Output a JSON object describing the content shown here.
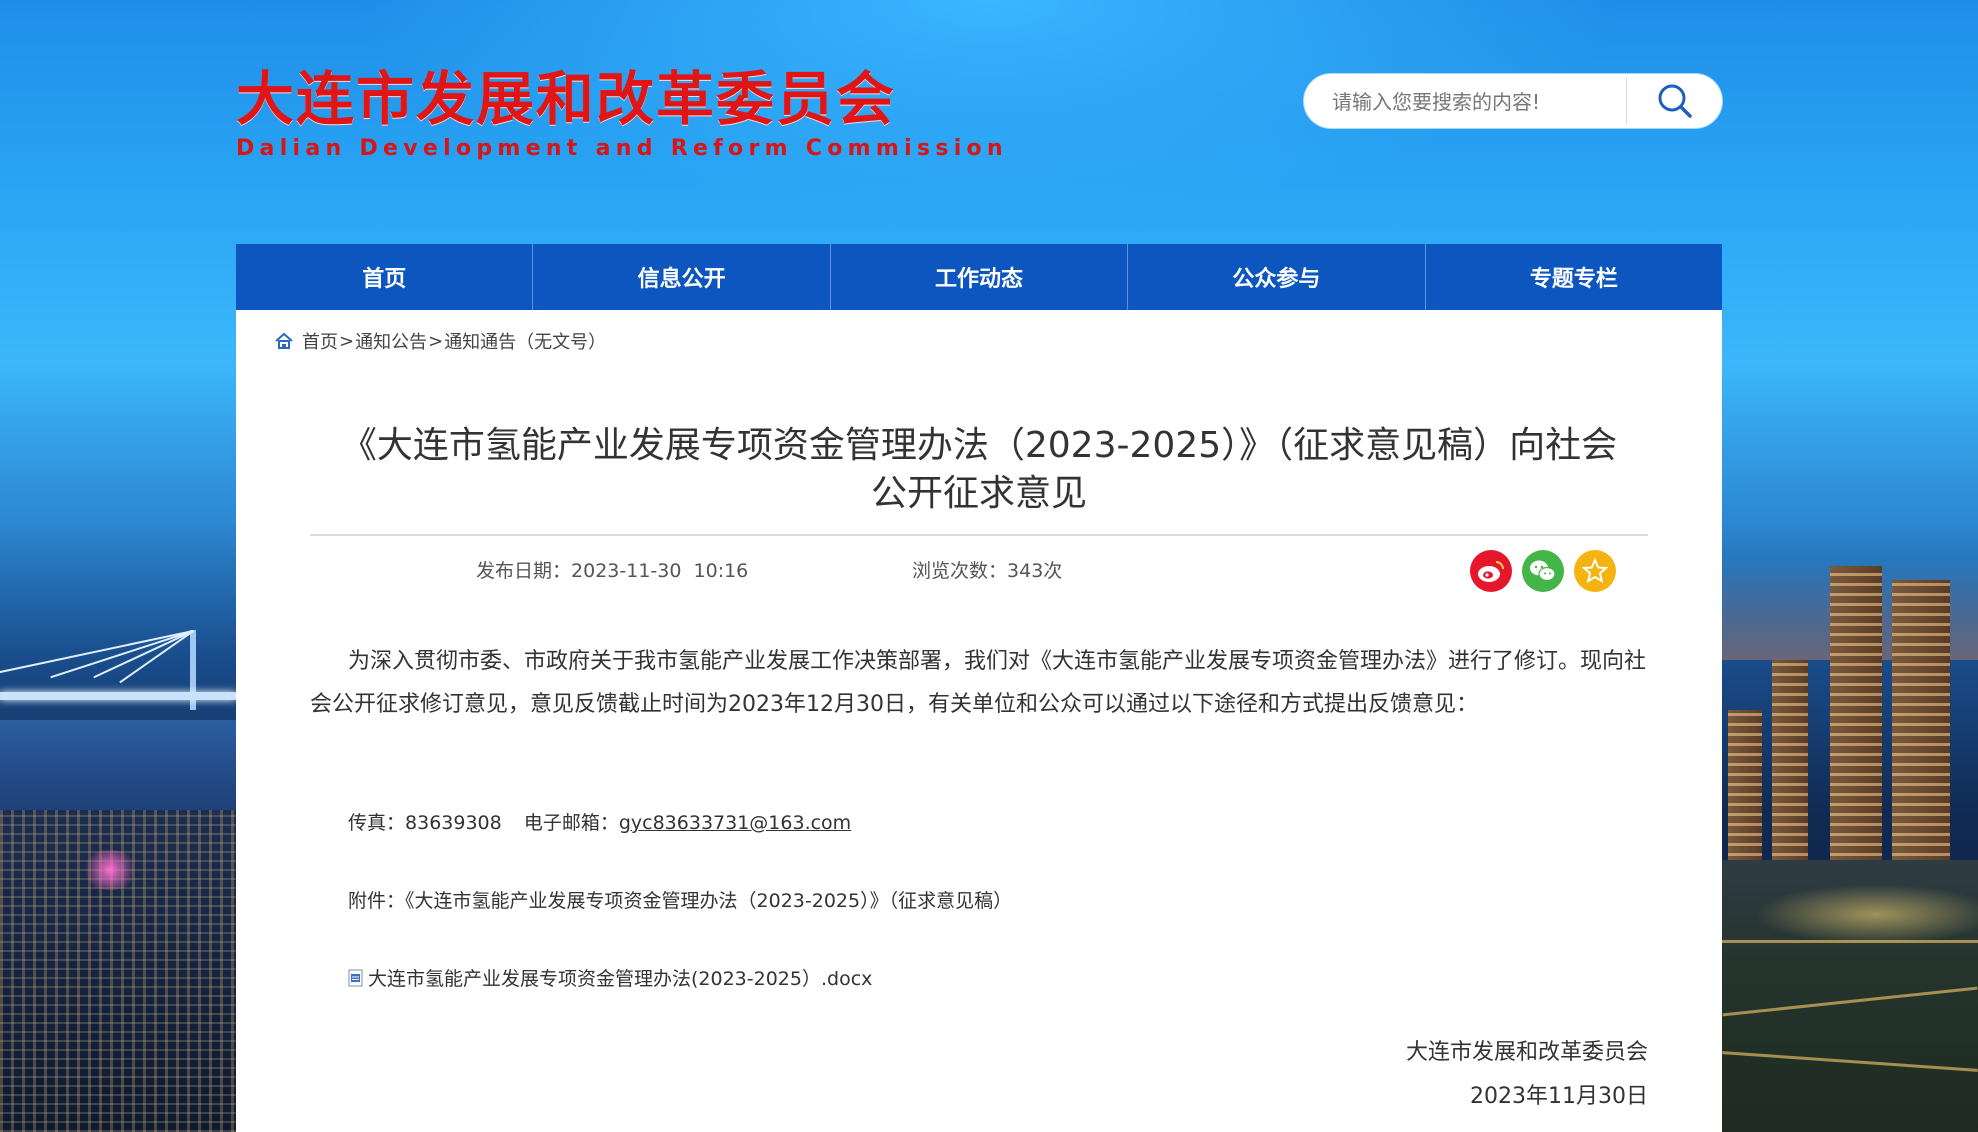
{
  "header": {
    "logo_cn": "大连市发展和改革委员会",
    "logo_en": "Dalian Development and Reform Commission",
    "search_placeholder": "请输入您要搜索的内容!",
    "search_icon": "search-icon"
  },
  "nav": {
    "items": [
      {
        "label": "首页"
      },
      {
        "label": "信息公开"
      },
      {
        "label": "工作动态"
      },
      {
        "label": "公众参与"
      },
      {
        "label": "专题专栏"
      }
    ]
  },
  "breadcrumb": {
    "icon": "home-icon",
    "items": [
      "首页",
      "通知公告",
      "通知通告（无文号）"
    ],
    "separator": ">"
  },
  "article": {
    "title_line1": "《大连市氢能产业发展专项资金管理办法（2023-2025）》（征求意见稿）向社会",
    "title_line2": "公开征求意见",
    "publish_label": "发布日期：",
    "publish_date": "2023-11-30  10:16",
    "views_label": "浏览次数：",
    "views": "343次",
    "share": [
      {
        "name": "weibo-icon",
        "color": "#e6162d"
      },
      {
        "name": "wechat-icon",
        "color": "#44b549"
      },
      {
        "name": "favorite-icon",
        "color": "#f5b312"
      }
    ],
    "body": "为深入贯彻市委、市政府关于我市氢能产业发展工作决策部署，我们对《大连市氢能产业发展专项资金管理办法》进行了修订。现向社会公开征求修订意见，意见反馈截止时间为2023年12月30日，有关单位和公众可以通过以下途径和方式提出反馈意见：",
    "fax_label": "传真：",
    "fax": "83639308",
    "email_label": "电子邮箱：",
    "email": "gyc83633731@163.com",
    "attachment_label": "附件：",
    "attachment_title": "《大连市氢能产业发展专项资金管理办法（2023-2025）》（征求意见稿）",
    "attachment_file": "大连市氢能产业发展专项资金管理办法(2023-2025）.docx",
    "signature_org": "大连市发展和改革委员会",
    "signature_date": "2023年11月30日"
  },
  "colors": {
    "nav_bg": "#0d56c0",
    "logo_red": "#e01515"
  }
}
